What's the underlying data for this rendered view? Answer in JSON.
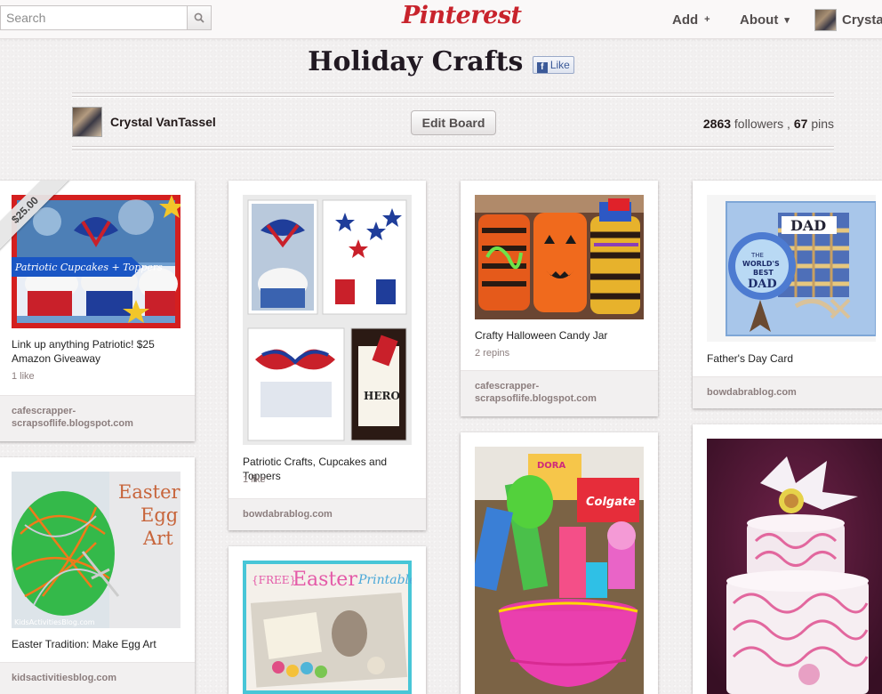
{
  "header": {
    "search_placeholder": "Search",
    "logo": "Pinterest",
    "add_label": "Add",
    "add_glyph": "+",
    "about_label": "About",
    "about_glyph": "▾",
    "user_label": "Crystal"
  },
  "board": {
    "title": "Holiday Crafts",
    "like_label": "Like",
    "owner_name": "Crystal VanTassel",
    "edit_label": "Edit Board",
    "followers_count": "2863",
    "followers_label": "followers",
    "pins_count": "67",
    "pins_label": "pins"
  },
  "pins": [
    {
      "price": "$25.00",
      "desc": "Link up anything Patriotic! $25 Amazon Giveaway",
      "meta": "1 like",
      "source": "cafescrapper-scrapsoflife.blogspot.com",
      "image_overlay": "Patriotic Cupcakes + Toppers"
    },
    {
      "desc": "Patriotic Crafts, Cupcakes and Toppers",
      "meta": "1 like",
      "source": "bowdabrablog.com"
    },
    {
      "desc": "Crafty Halloween Candy Jar",
      "meta": "2 repins",
      "source": "cafescrapper-scrapsoflife.blogspot.com"
    },
    {
      "desc": "Father's Day Card",
      "source": "bowdabrablog.com",
      "image_text": [
        "DAD",
        "THE",
        "WORLD'S",
        "BEST",
        "DAD"
      ]
    },
    {
      "desc": "Easter Tradition: Make Egg Art",
      "source": "kidsactivitiesblog.com",
      "image_text": [
        "Easter",
        "Egg",
        "Art"
      ],
      "watermark": "KidsActivitiesBlog.com"
    },
    {
      "image_text": [
        "{FREE}",
        "Easter",
        "Printable"
      ]
    },
    {
      "image_text": [
        "DORA",
        "Colgate"
      ]
    },
    {}
  ],
  "colors": {
    "brand": "#c8232c",
    "background": "#f2f0f0",
    "source_text": "#8c7e7e"
  }
}
